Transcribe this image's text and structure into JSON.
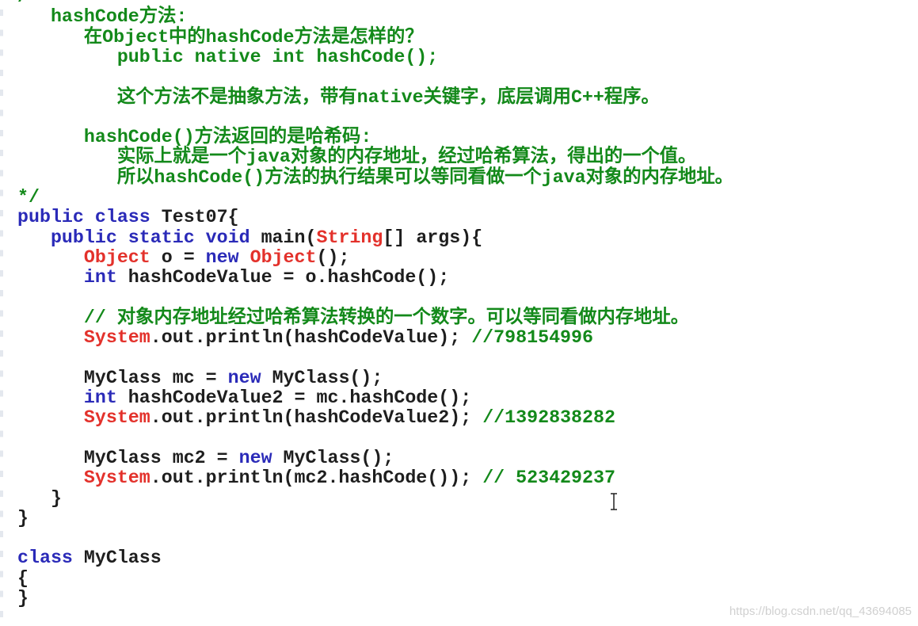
{
  "editor": {
    "colors": {
      "comment": "#13891a",
      "keyword": "#2a2ab8",
      "type": "#e3312b",
      "plain": "#1e1e1e"
    },
    "lines": [
      [
        {
          "t": "/*",
          "c": "comment"
        }
      ],
      [
        {
          "t": "   hashCode方法:",
          "c": "comment"
        }
      ],
      [
        {
          "t": "      在Object中的hashCode方法是怎样的？",
          "c": "comment"
        }
      ],
      [
        {
          "t": "         public native int hashCode();",
          "c": "comment"
        }
      ],
      [],
      [
        {
          "t": "         这个方法不是抽象方法，带有native关键字，底层调用C++程序。",
          "c": "comment"
        }
      ],
      [],
      [
        {
          "t": "      hashCode()方法返回的是哈希码:",
          "c": "comment"
        }
      ],
      [
        {
          "t": "         实际上就是一个java对象的内存地址，经过哈希算法，得出的一个值。",
          "c": "comment"
        }
      ],
      [
        {
          "t": "         所以hashCode()方法的执行结果可以等同看做一个java对象的内存地址。",
          "c": "comment"
        }
      ],
      [
        {
          "t": "*/",
          "c": "comment"
        }
      ],
      [
        {
          "t": "public class",
          "c": "keyword"
        },
        {
          "t": " Test07{",
          "c": "plain"
        }
      ],
      [
        {
          "t": "   public static void",
          "c": "keyword"
        },
        {
          "t": " main(",
          "c": "plain"
        },
        {
          "t": "String",
          "c": "type"
        },
        {
          "t": "[] args){",
          "c": "plain"
        }
      ],
      [
        {
          "t": "      Object",
          "c": "type"
        },
        {
          "t": " o = ",
          "c": "plain"
        },
        {
          "t": "new",
          "c": "keyword"
        },
        {
          "t": " Object",
          "c": "type"
        },
        {
          "t": "();",
          "c": "plain"
        }
      ],
      [
        {
          "t": "      int",
          "c": "keyword"
        },
        {
          "t": " hashCodeValue = o.hashCode();",
          "c": "plain"
        }
      ],
      [],
      [
        {
          "t": "      // 对象内存地址经过哈希算法转换的一个数字。可以等同看做内存地址。",
          "c": "comment"
        }
      ],
      [
        {
          "t": "      System",
          "c": "type"
        },
        {
          "t": ".out.println(hashCodeValue); ",
          "c": "plain"
        },
        {
          "t": "//798154996",
          "c": "comment"
        }
      ],
      [],
      [
        {
          "t": "      MyClass mc = ",
          "c": "plain"
        },
        {
          "t": "new",
          "c": "keyword"
        },
        {
          "t": " MyClass();",
          "c": "plain"
        }
      ],
      [
        {
          "t": "      int",
          "c": "keyword"
        },
        {
          "t": " hashCodeValue2 = mc.hashCode();",
          "c": "plain"
        }
      ],
      [
        {
          "t": "      System",
          "c": "type"
        },
        {
          "t": ".out.println(hashCodeValue2); ",
          "c": "plain"
        },
        {
          "t": "//1392838282",
          "c": "comment"
        }
      ],
      [],
      [
        {
          "t": "      MyClass mc2 = ",
          "c": "plain"
        },
        {
          "t": "new",
          "c": "keyword"
        },
        {
          "t": " MyClass();",
          "c": "plain"
        }
      ],
      [
        {
          "t": "      System",
          "c": "type"
        },
        {
          "t": ".out.println(mc2.hashCode()); ",
          "c": "plain"
        },
        {
          "t": "// 523429237",
          "c": "comment"
        }
      ],
      [
        {
          "t": "   }",
          "c": "plain"
        }
      ],
      [
        {
          "t": "}",
          "c": "plain"
        }
      ],
      [],
      [
        {
          "t": "class",
          "c": "keyword"
        },
        {
          "t": " MyClass",
          "c": "plain"
        }
      ],
      [
        {
          "t": "{",
          "c": "plain"
        }
      ],
      [
        {
          "t": "}",
          "c": "plain"
        }
      ]
    ]
  },
  "cursor_icon": "text-cursor-ibeam-icon",
  "watermark": "https://blog.csdn.net/qq_43694085"
}
